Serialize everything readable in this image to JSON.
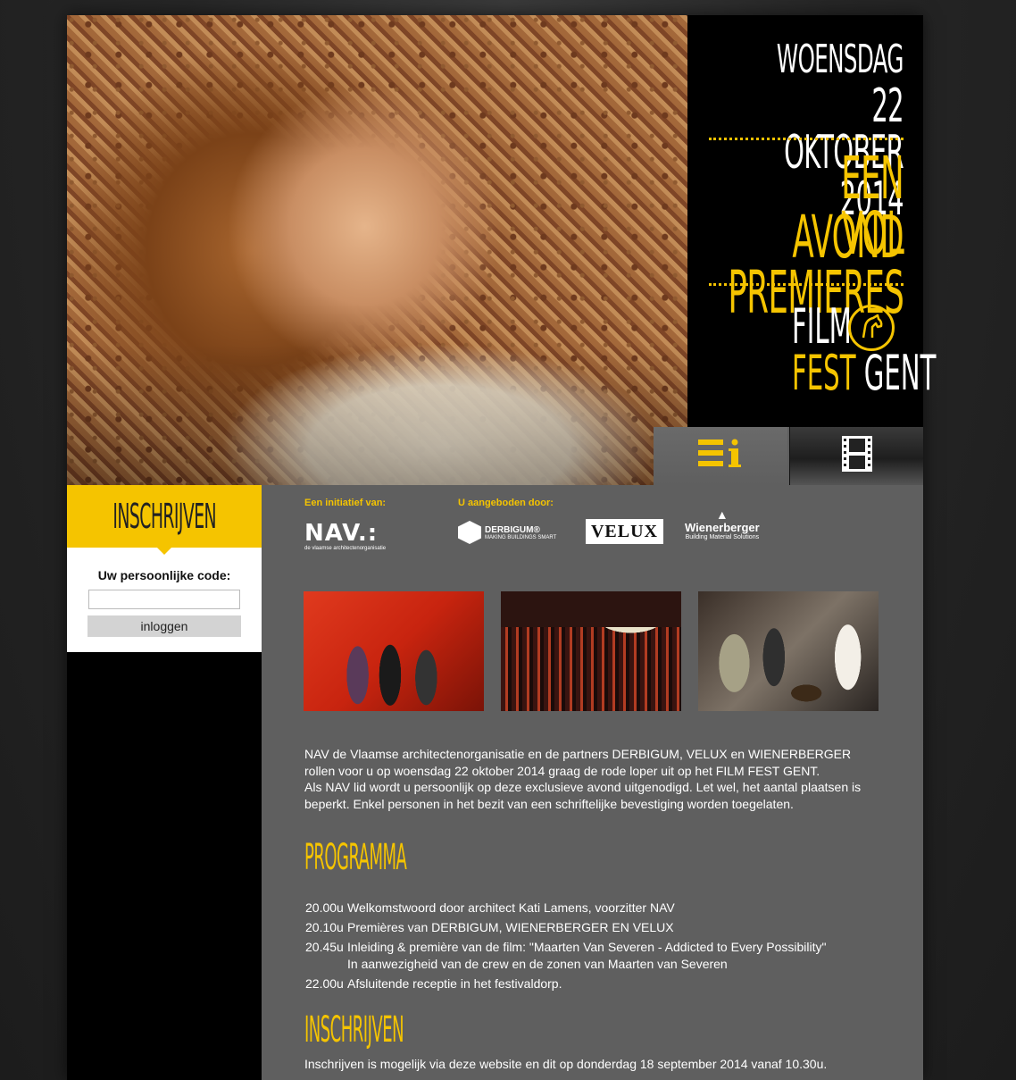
{
  "hero": {
    "day": "WOENSDAG",
    "date": "22 OKTOBER 2014",
    "tagline_1": "EEN AVOND",
    "tagline_2": "VOL PREMIERES",
    "logo_film": "FILM",
    "logo_fest": "FEST",
    "logo_gent": "GENT"
  },
  "tabs": [
    {
      "name": "info",
      "icon": "info-list-icon",
      "active": true
    },
    {
      "name": "film",
      "icon": "film-strip-icon",
      "active": false
    }
  ],
  "sidebar": {
    "heading": "INSCHRIJVEN",
    "code_label": "Uw persoonlijke code:",
    "code_value": "",
    "login_button": "inloggen"
  },
  "sponsors": {
    "initiative_label": "Een initiatief van:",
    "offered_label": "U aangeboden door:",
    "nav_logo": "NAV.:",
    "nav_sub": "de vlaamse architectenorganisatie",
    "derbigum": "DERBIGUM®",
    "derbigum_sub": "MAKING BUILDINGS SMART",
    "velux": "VELUX",
    "wienerberger": "Wienerberger",
    "wienerberger_sub": "Building Material Solutions"
  },
  "intro": {
    "paragraph_1": "NAV de Vlaamse architectenorganisatie en de partners DERBIGUM, VELUX en WIENERBERGER rollen voor u op woensdag 22 oktober 2014 graag de rode loper uit op het FILM FEST GENT.",
    "paragraph_2": "Als NAV lid wordt u persoonlijk op deze exclusieve avond uitgenodigd. Let wel, het aantal plaatsen is beperkt. Enkel personen in het bezit van een schriftelijke bevestiging worden toegelaten."
  },
  "program": {
    "title": "PROGRAMMA",
    "items": [
      {
        "time": "20.00u",
        "text": "Welkomstwoord door architect Kati Lamens, voorzitter NAV"
      },
      {
        "time": "20.10u",
        "text": "Premières van DERBIGUM, WIENERBERGER EN VELUX"
      },
      {
        "time": "20.45u",
        "text": "Inleiding & première van de film: \"Maarten Van Severen - Addicted to Every Possibility\"",
        "sub": "In aanwezigheid van de crew en de zonen van Maarten van Severen"
      },
      {
        "time": "22.00u",
        "text": "Afsluitende receptie in het festivaldorp."
      }
    ]
  },
  "registration": {
    "title": "INSCHRIJVEN",
    "text": "Inschrijven is mogelijk via deze website en dit op donderdag 18 september 2014 vanaf 10.30u."
  },
  "colors": {
    "accent": "#f5c400",
    "content_bg": "#5f5f5f",
    "panel_bg": "#000000"
  }
}
